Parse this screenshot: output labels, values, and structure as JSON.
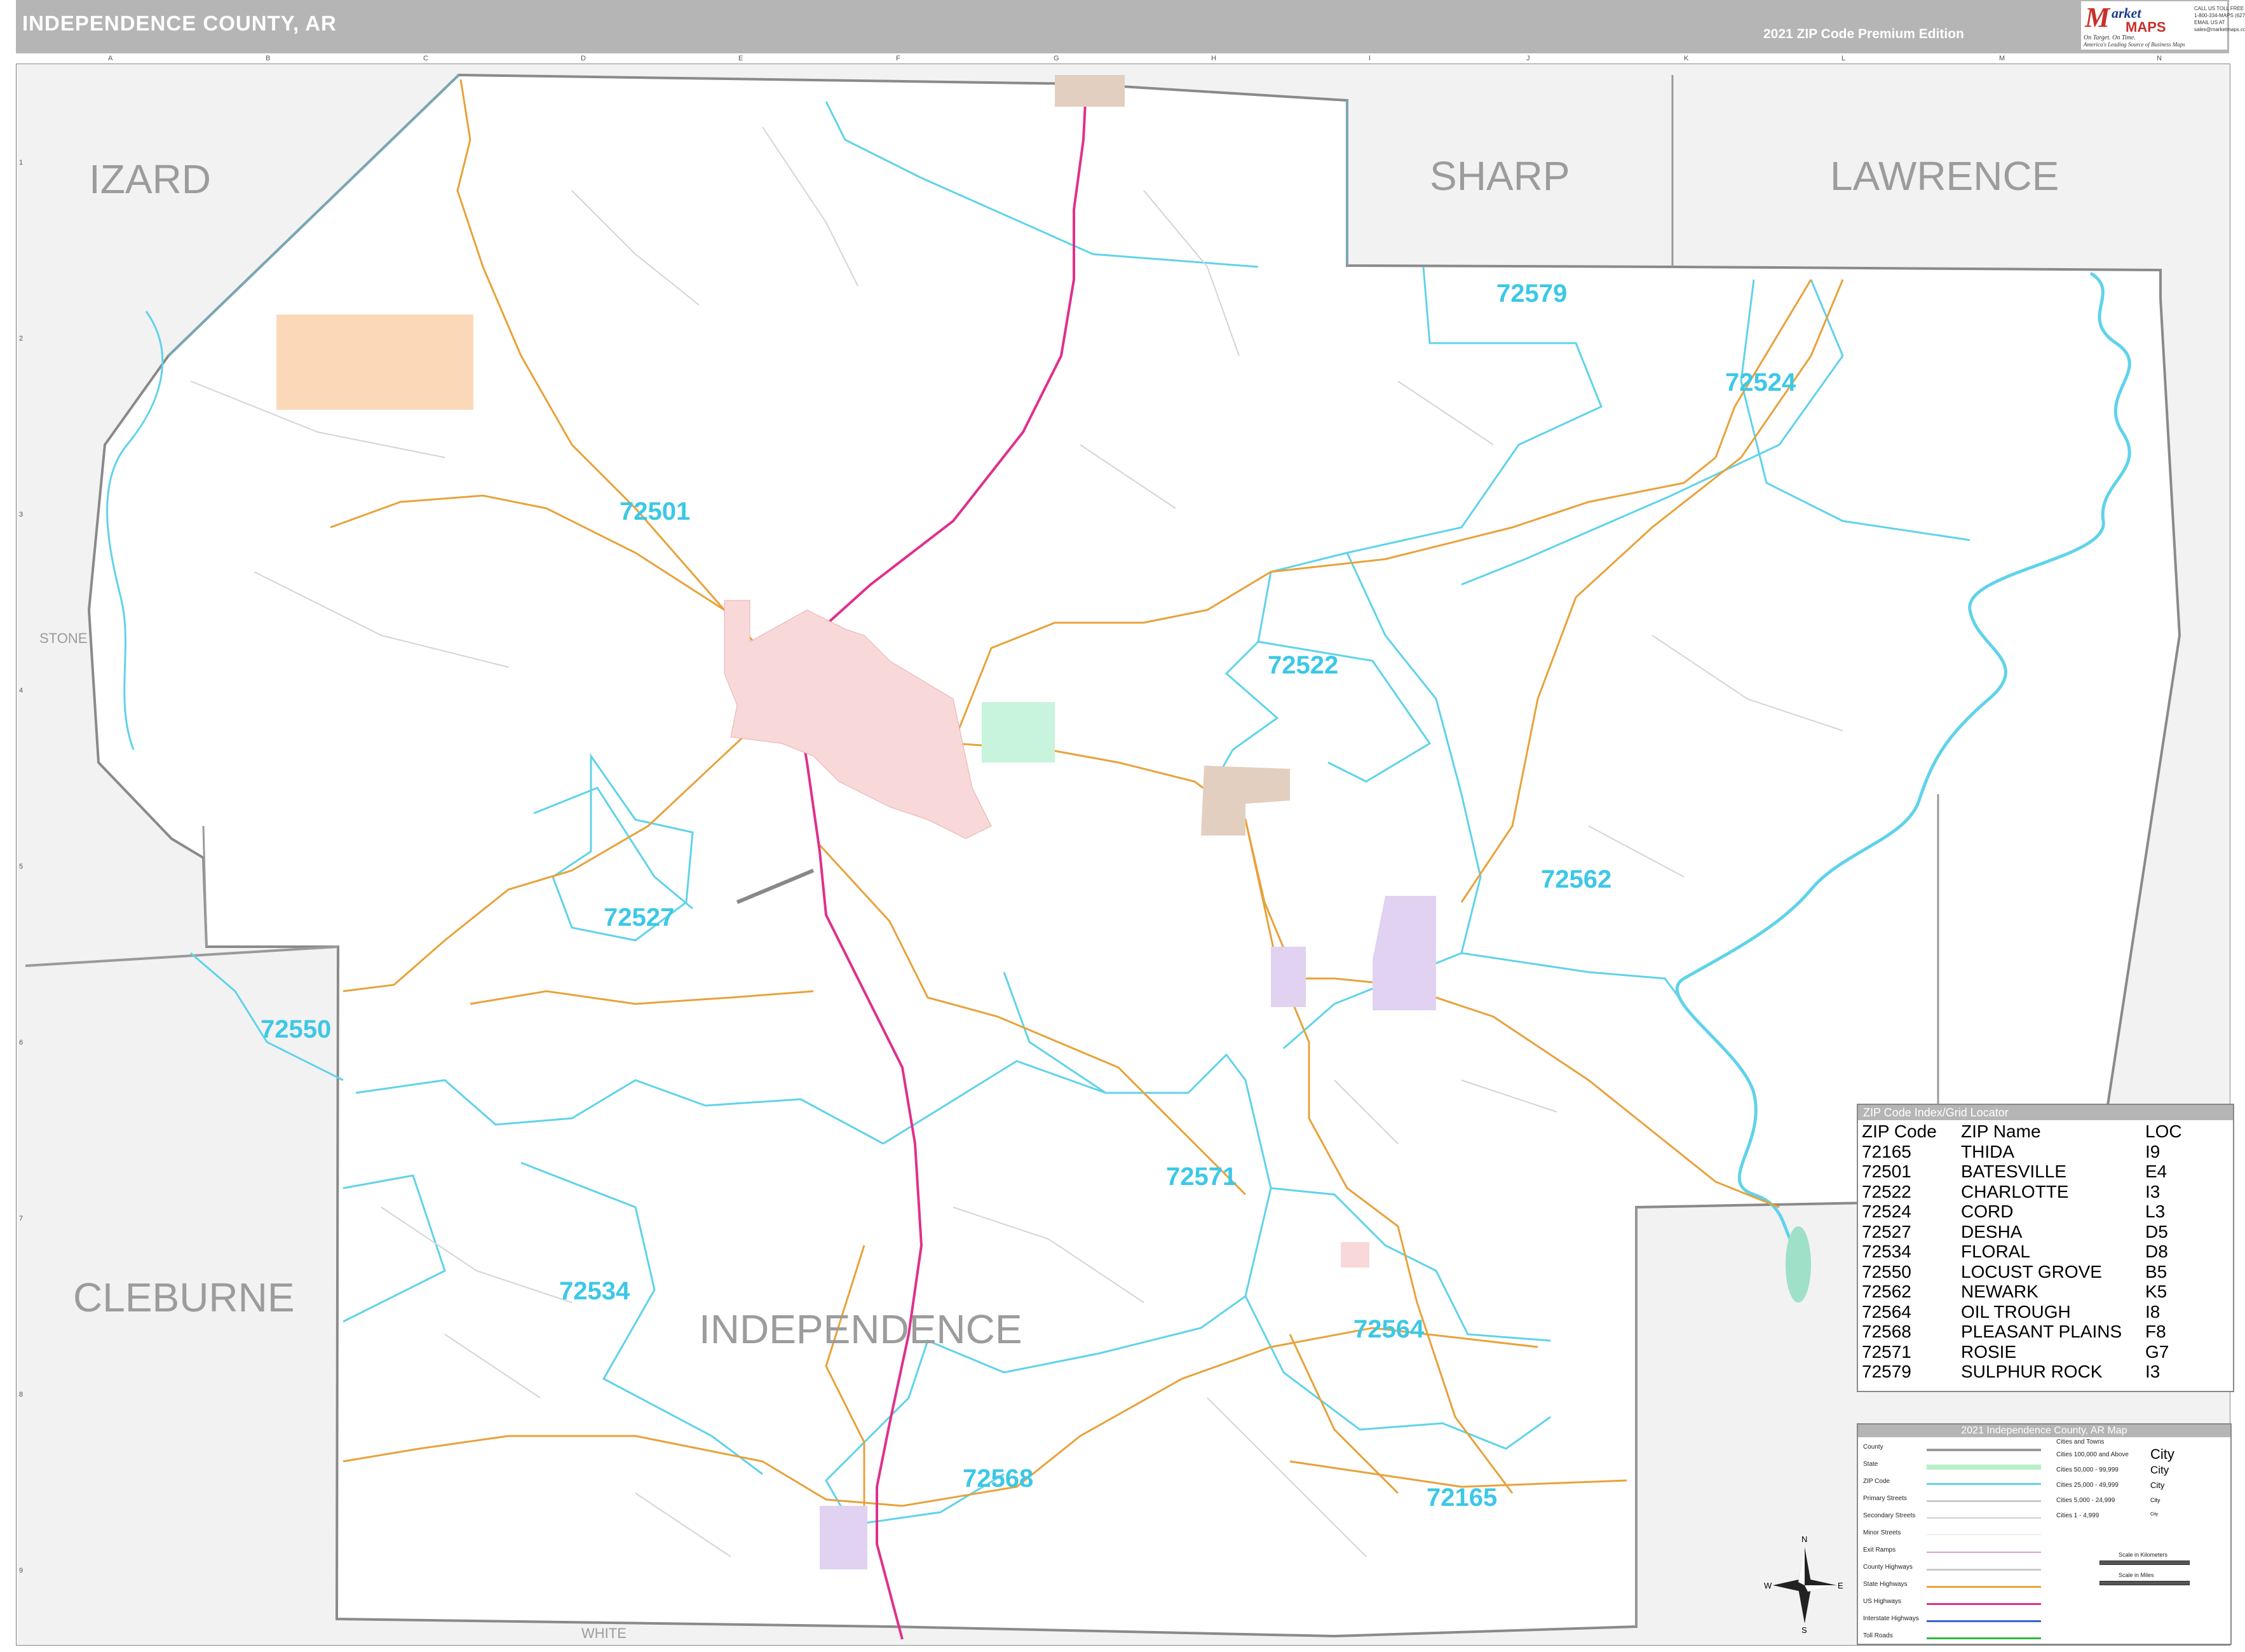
{
  "header": {
    "title": "INDEPENDENCE COUNTY, AR",
    "edition": "2021 ZIP Code Premium Edition"
  },
  "logo": {
    "letter": "M",
    "word1": "arket",
    "word2": "MAPS",
    "tagline": "On Target. On Time.",
    "tagline2": "America's Leading Source of Business Maps",
    "contact": [
      "CALL US TOLL FREE",
      "1-800-334-MAPS (6277)",
      "EMAIL US AT",
      "sales@marketmaps.com"
    ]
  },
  "grid": {
    "columns": [
      "A",
      "B",
      "C",
      "D",
      "E",
      "F",
      "G",
      "H",
      "I",
      "J",
      "K",
      "L",
      "M",
      "N"
    ],
    "rows": [
      "1",
      "2",
      "3",
      "4",
      "5",
      "6",
      "7",
      "8",
      "9"
    ]
  },
  "counties": {
    "izard": "IZARD",
    "sharp": "SHARP",
    "lawrence": "LAWRENCE",
    "cleburne": "CLEBURNE",
    "independence": "INDEPENDENCE",
    "stone": "STONE",
    "white": "WHITE"
  },
  "zip_labels": {
    "z72579": "72579",
    "z72524": "72524",
    "z72501": "72501",
    "z72522": "72522",
    "z72562": "72562",
    "z72527": "72527",
    "z72550": "72550",
    "z72571": "72571",
    "z72534": "72534",
    "z72564": "72564",
    "z72568": "72568",
    "z72165": "72165"
  },
  "zip_index": {
    "title": "ZIP Code Index/Grid Locator",
    "headers": [
      "ZIP Code",
      "ZIP Name",
      "LOC"
    ],
    "rows": [
      [
        "72165",
        "THIDA",
        "I9"
      ],
      [
        "72501",
        "BATESVILLE",
        "E4"
      ],
      [
        "72522",
        "CHARLOTTE",
        "I3"
      ],
      [
        "72524",
        "CORD",
        "L3"
      ],
      [
        "72527",
        "DESHA",
        "D5"
      ],
      [
        "72534",
        "FLORAL",
        "D8"
      ],
      [
        "72550",
        "LOCUST GROVE",
        "B5"
      ],
      [
        "72562",
        "NEWARK",
        "K5"
      ],
      [
        "72564",
        "OIL TROUGH",
        "I8"
      ],
      [
        "72568",
        "PLEASANT PLAINS",
        "F8"
      ],
      [
        "72571",
        "ROSIE",
        "G7"
      ],
      [
        "72579",
        "SULPHUR ROCK",
        "I3"
      ]
    ]
  },
  "legend": {
    "title": "2021 Independence County, AR Map",
    "items": [
      "County",
      "State",
      "ZIP Code",
      "Primary Streets",
      "Secondary Streets",
      "Minor Streets",
      "Exit Ramps",
      "County Highways",
      "State Highways",
      "US Highways",
      "Interstate Highways",
      "Toll Roads"
    ],
    "cities_title": "Cities and Towns",
    "city_classes": [
      "Cities 100,000 and Above",
      "Cities 50,000 - 99,999",
      "Cities 25,000 - 49,999",
      "Cities 5,000 - 24,999",
      "Cities 1 - 4,999"
    ],
    "city_samples": [
      "City",
      "City",
      "City",
      "City",
      "City"
    ],
    "scale_km": "Scale in Kilometers",
    "scale_mi": "Scale in Miles",
    "colors": {
      "county": "#9a9a9a",
      "state": "#b8f0c8",
      "zip": "#5fd3ea",
      "primary": "#c9c9c9",
      "secondary": "#d0d0d0",
      "minor": "#e0e0e0",
      "exit": "#d9a0d0",
      "county_hwy": "#c9c9c9",
      "state_hwy": "#e8a23a",
      "us_hwy": "#e0308c",
      "interstate": "#3a5fd0",
      "toll": "#30b840"
    }
  },
  "compass": {
    "n": "N",
    "s": "S",
    "e": "E",
    "w": "W"
  }
}
